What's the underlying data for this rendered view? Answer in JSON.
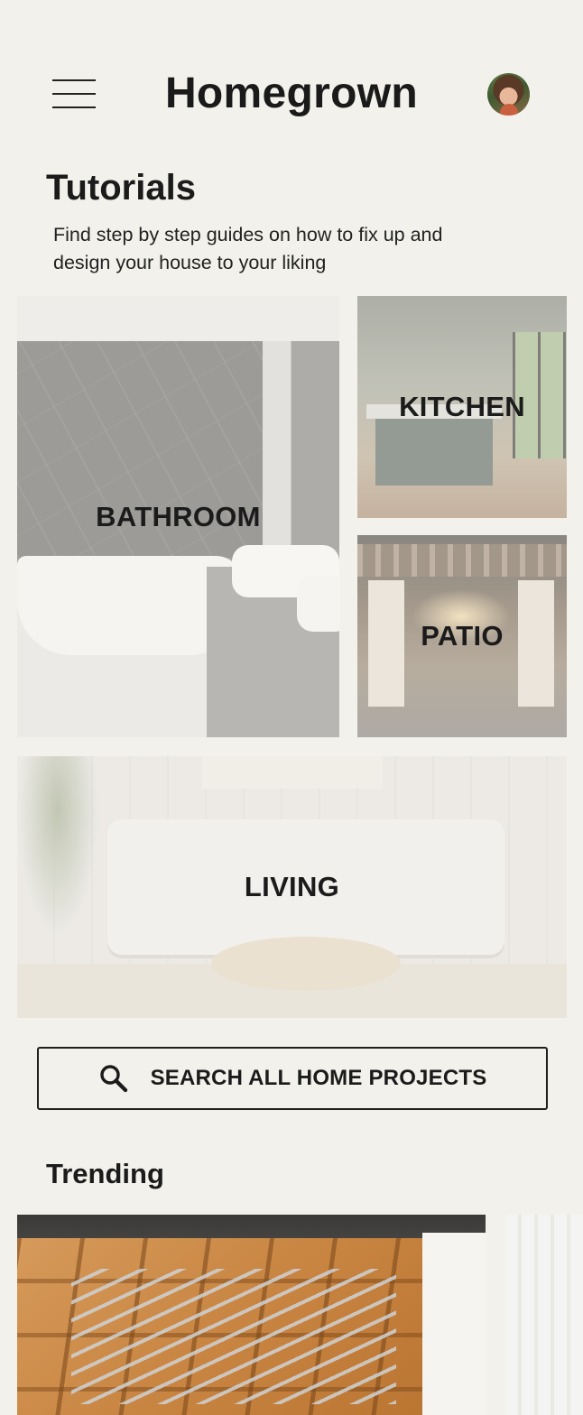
{
  "header": {
    "title": "Homegrown",
    "menu_icon": "hamburger-menu-icon",
    "avatar_icon": "profile-avatar"
  },
  "tutorials": {
    "title": "Tutorials",
    "description": "Find step by step guides on how to fix up and design your house to your liking",
    "tiles": [
      {
        "label": "BATHROOM"
      },
      {
        "label": "KITCHEN"
      },
      {
        "label": "PATIO"
      },
      {
        "label": "LIVING"
      }
    ]
  },
  "search": {
    "label": "SEARCH ALL HOME PROJECTS",
    "icon": "search-icon"
  },
  "trending": {
    "title": "Trending"
  },
  "colors": {
    "background": "#f3f1eb",
    "text": "#1b1b1b"
  }
}
